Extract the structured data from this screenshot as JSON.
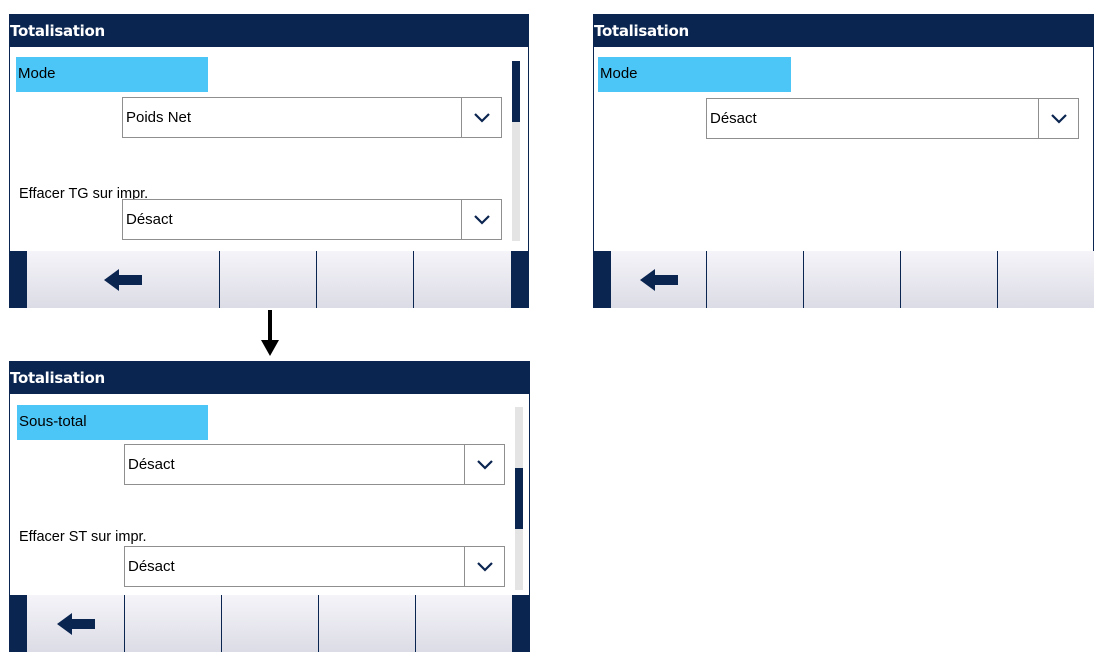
{
  "screens": {
    "top_left": {
      "title": "Totalisation",
      "selected_label": "Mode",
      "mode_value": "Poids Net",
      "field2_label": "Effacer TG sur impr.",
      "field2_value": "Désact",
      "scroll_position": 0.0
    },
    "top_right": {
      "title": "Totalisation",
      "selected_label": "Mode",
      "mode_value": "Désact"
    },
    "bottom_left": {
      "title": "Totalisation",
      "selected_label": "Sous-total",
      "field1_value": "Désact",
      "field2_label": "Effacer ST sur impr.",
      "field2_value": "Désact",
      "scroll_position": 0.5
    }
  },
  "icons": {
    "back": "arrow-left-icon",
    "dropdown": "chevron-down-icon",
    "flow": "arrow-down-icon"
  },
  "colors": {
    "titlebar": "#0a2550",
    "highlight": "#4cc6f7",
    "softkey_bar": "#e8e8ef"
  }
}
